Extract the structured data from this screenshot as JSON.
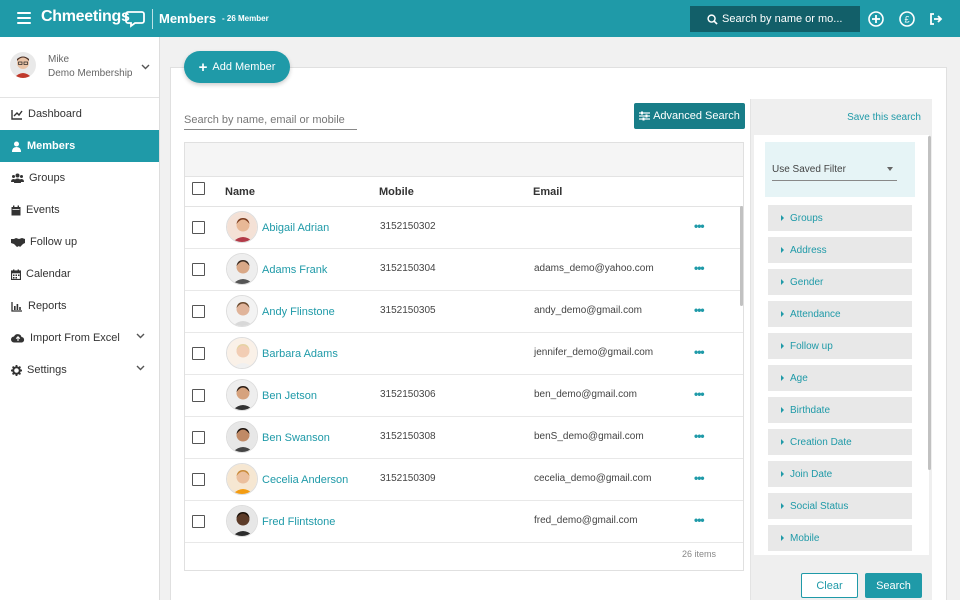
{
  "header": {
    "logo": "Chmeetings",
    "title": "Members",
    "member_count": "- 26 Member",
    "search_text": "Search by name or mo...",
    "accent": "#1f9aa8",
    "search_bg": "#125f69"
  },
  "user": {
    "name": "Mike",
    "subtitle": "Demo Membership"
  },
  "sidebar": {
    "items": [
      {
        "label": "Dashboard",
        "icon": "chart-line-icon"
      },
      {
        "label": "Members",
        "icon": "user-icon",
        "active": true
      },
      {
        "label": "Groups",
        "icon": "users-icon"
      },
      {
        "label": "Events",
        "icon": "calendar-icon"
      },
      {
        "label": "Follow up",
        "icon": "handshake-icon"
      },
      {
        "label": "Calendar",
        "icon": "calendar-grid-icon"
      },
      {
        "label": "Reports",
        "icon": "bar-chart-icon"
      },
      {
        "label": "Import From Excel",
        "icon": "cloud-upload-icon",
        "has_submenu": true
      },
      {
        "label": "Settings",
        "icon": "gear-icon",
        "has_submenu": true
      }
    ]
  },
  "main": {
    "add_member_label": "Add Member",
    "search_placeholder": "Search by name, email or mobile",
    "advanced_search_label": "Advanced Search",
    "columns": [
      "Name",
      "Mobile",
      "Email"
    ],
    "rows": [
      {
        "name": "Abigail Adrian",
        "mobile": "3152150302",
        "email": ""
      },
      {
        "name": "Adams Frank",
        "mobile": "3152150304",
        "email": "adams_demo@yahoo.com"
      },
      {
        "name": "Andy Flinstone",
        "mobile": "3152150305",
        "email": "andy_demo@gmail.com"
      },
      {
        "name": "Barbara Adams",
        "mobile": "",
        "email": "jennifer_demo@gmail.com"
      },
      {
        "name": "Ben Jetson",
        "mobile": "3152150306",
        "email": "ben_demo@gmail.com"
      },
      {
        "name": "Ben Swanson",
        "mobile": "3152150308",
        "email": "benS_demo@gmail.com"
      },
      {
        "name": "Cecelia Anderson",
        "mobile": "3152150309",
        "email": "cecelia_demo@gmail.com"
      },
      {
        "name": "Fred Flintstone",
        "mobile": "",
        "email": "fred_demo@gmail.com"
      }
    ],
    "row_actions_label": "•••",
    "items_count": "26 items"
  },
  "filters": {
    "save_search_label": "Save this search",
    "saved_filter_value": "Use Saved Filter",
    "items": [
      "Groups",
      "Address",
      "Gender",
      "Attendance",
      "Follow up",
      "Age",
      "Birthdate",
      "Creation Date",
      "Join Date",
      "Social Status",
      "Mobile"
    ],
    "clear_label": "Clear",
    "search_label": "Search"
  }
}
